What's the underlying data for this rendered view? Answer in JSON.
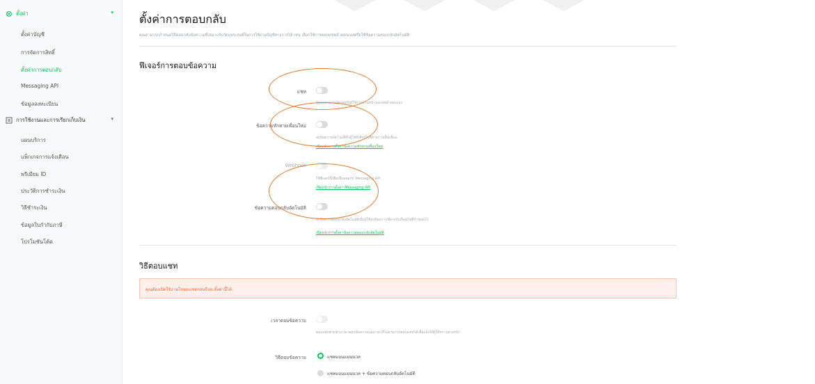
{
  "sidebar": {
    "settings_group": "ตั้งค่า",
    "settings_items": [
      "ตั้งค่าบัญชี",
      "การจัดการสิทธิ์",
      "ตั้งค่าการตอบกลับ",
      "Messaging API",
      "ข้อมูลลงทะเบียน"
    ],
    "billing_group": "การใช้งานและการเรียกเก็บเงิน",
    "billing_items": [
      "แผนบริการ",
      "แพ็กเกจการแจ้งเตือน",
      "พรีเมียม ID",
      "ประวัติการชำระเงิน",
      "วิธีชำระเงิน",
      "ข้อมูลใบกำกับภาษี",
      "โปรโมชันโค้ด"
    ]
  },
  "page": {
    "title": "ตั้งค่าการตอบกลับ",
    "description": "คุณสามารถกำหนดวิธีตอบกลับข้อความที่เหมาะกับวัตถุประสงค์ในการใช้งานบัญชีทางการได้ เช่น เลือกใช้การตอบแชทด้วยตนเองหรือใช้ข้อความตอบกลับอัตโนมัติ"
  },
  "features": {
    "title": "ฟีเจอร์การตอบข้อความ",
    "chat_label": "แชท",
    "chat_help": "ผู้ดูแลสามารถพูดคุยกับผู้ใช้งานผ่านหน้าจอแชทด้วยตนเอง",
    "greeting_label": "ข้อความทักทายเพื่อนใหม่",
    "greeting_help": "ส่งข้อความอัตโนมัติถึงผู้ใช้ที่เพิ่มบัญชีทางการเป็นเพื่อน",
    "greeting_link": "เปิดหน้าการตั้งค่าข้อความทักทายเพื่อนใหม่",
    "webhook_label": "Webhook",
    "webhook_help": "ใช้ฟีเจอร์นี้เพื่อเชื่อมต่อกับ Messaging API",
    "webhook_link": "เปิดหน้าการตั้งค่า Messaging API",
    "auto_label": "ข้อความตอบกลับอัตโนมัติ",
    "auto_help": "ส่งข้อความตอบกลับอัตโนมัติเมื่อผู้ใช้ส่งข้อความที่ตรงกับเงื่อนไขที่กำหนดไว้",
    "auto_link": "เปิดหน้าการตั้งค่าข้อความตอบกลับอัตโนมัติ"
  },
  "chat_method": {
    "title": "วิธีตอบแชท",
    "alert": "คุณต้องเปิดใช้งานโหมดแชทก่อนจึงจะตั้งค่านี้ได้",
    "hours_label": "เวลาตอบข้อความ",
    "hours_help": "ตอบกลับตามช่วงเวลาตอบข้อความและเวลาที่ไม่สามารถตอบแชทได้เพื่อแจ้งให้ผู้ใช้ทราบล่วงหน้า",
    "method_label": "วิธีตอบข้อความ",
    "option1": "แชทแบบแมนนวล",
    "option2": "แชทแบบแมนนวล + ข้อความตอบกลับอัตโนมัติ"
  },
  "colors": {
    "accent": "#06c755",
    "annotation": "#e0782a",
    "alert_bg": "#fdf0ea",
    "alert_text": "#e8663a"
  }
}
